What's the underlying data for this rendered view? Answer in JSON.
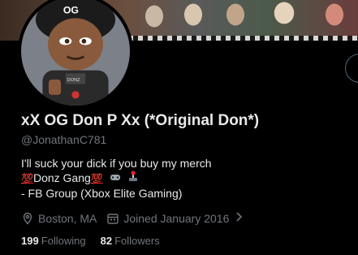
{
  "profile": {
    "display_name": "xX OG Don P Xx (*Original Don*)",
    "handle": "@JonathanC781",
    "bio": {
      "line1": "I'll suck your dick if you buy my merch",
      "line2_prefix_emoji": "💯",
      "line2_text": "Donz Gang",
      "line2_suffix_emoji": "💯",
      "line2_icons": [
        "gamepad-icon",
        "joystick-icon"
      ],
      "line3": "- FB Group (Xbox Elite Gaming)"
    },
    "location": "Boston, MA",
    "joined": "Joined January 2016",
    "following_count": "199",
    "following_label": "Following",
    "followers_count": "82",
    "followers_label": "Followers"
  },
  "icons": {
    "location": "location-pin-icon",
    "calendar": "calendar-icon",
    "chevron": "chevron-right-icon"
  },
  "colors": {
    "background": "#000000",
    "primary_text": "#e7e9ea",
    "secondary_text": "#71767b"
  }
}
